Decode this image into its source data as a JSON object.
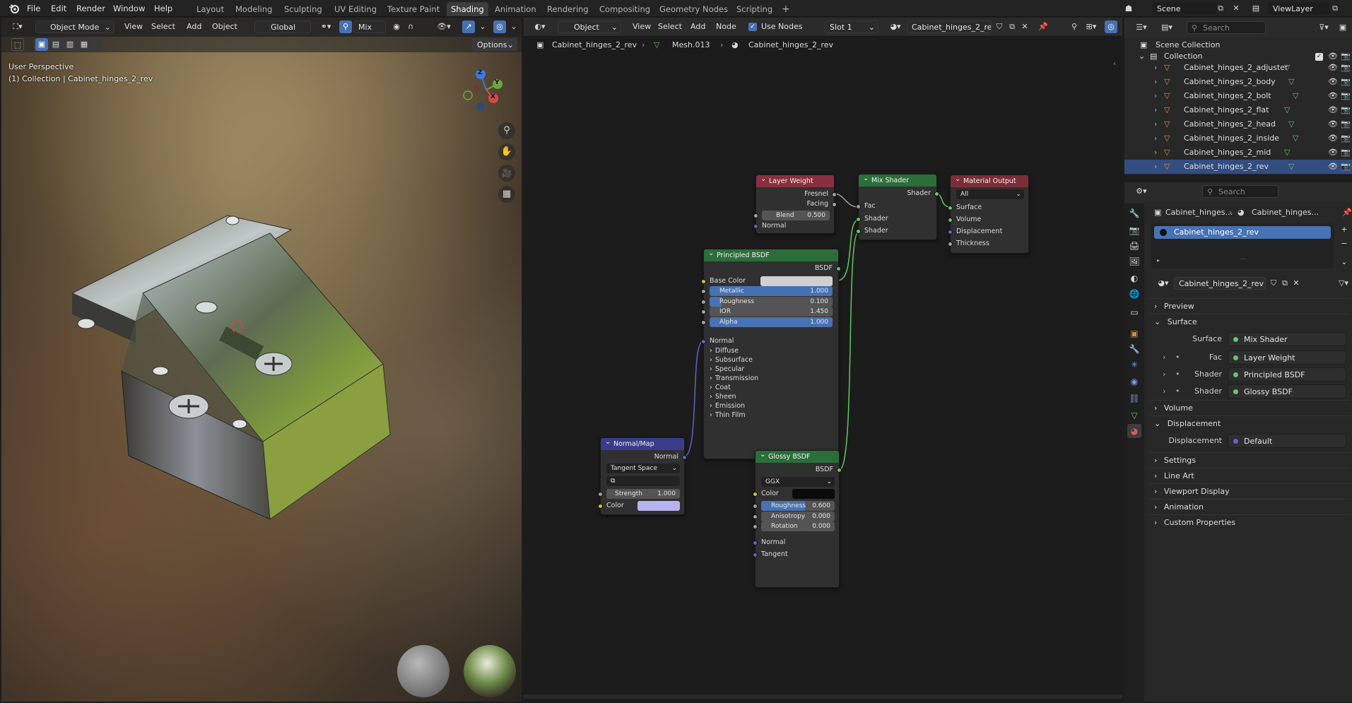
{
  "menus": [
    "File",
    "Edit",
    "Render",
    "Window",
    "Help"
  ],
  "workspaces": [
    "Layout",
    "Modeling",
    "Sculpting",
    "UV Editing",
    "Texture Paint",
    "Shading",
    "Animation",
    "Rendering",
    "Compositing",
    "Geometry Nodes",
    "Scripting"
  ],
  "active_workspace": "Shading",
  "add_workspace": "+",
  "scene_name": "Scene",
  "view_layer": "ViewLayer",
  "viewport": {
    "mode": "Object Mode",
    "menu": [
      "View",
      "Select",
      "Add",
      "Object"
    ],
    "orientation": "Global",
    "proportional": "Mix",
    "options_label": "Options",
    "overlay_line1": "User Perspective",
    "overlay_line2": "(1) Collection | Cabinet_hinges_2_rev",
    "gizmo_axes": {
      "z": "Z",
      "y": "Y",
      "x": "X"
    }
  },
  "node_editor": {
    "type": "Object",
    "menu": [
      "View",
      "Select",
      "Add",
      "Node"
    ],
    "use_nodes_label": "Use Nodes",
    "slot": "Slot 1",
    "material": "Cabinet_hinges_2_rev",
    "breadcrumb": [
      "Cabinet_hinges_2_rev",
      "Mesh.013",
      "Cabinet_hinges_2_rev"
    ],
    "nodes": {
      "layer_weight": {
        "title": "Layer Weight",
        "out1": "Fresnel",
        "out2": "Facing",
        "blend_label": "Blend",
        "blend_value": "0.500",
        "normal": "Normal"
      },
      "mix_shader": {
        "title": "Mix Shader",
        "out": "Shader",
        "in1": "Fac",
        "in2": "Shader",
        "in3": "Shader"
      },
      "material_output": {
        "title": "Material Output",
        "target": "All",
        "in1": "Surface",
        "in2": "Volume",
        "in3": "Displacement",
        "in4": "Thickness"
      },
      "principled": {
        "title": "Principled BSDF",
        "out": "BSDF",
        "base_color": "Base Color",
        "fields": [
          {
            "label": "Metallic",
            "value": "1.000",
            "fill": 1.0
          },
          {
            "label": "Roughness",
            "value": "0.100",
            "fill": 0.1
          },
          {
            "label": "IOR",
            "value": "1.450",
            "fill": 0
          },
          {
            "label": "Alpha",
            "value": "1.000",
            "fill": 1.0
          }
        ],
        "normal": "Normal",
        "panels": [
          "Diffuse",
          "Subsurface",
          "Specular",
          "Transmission",
          "Coat",
          "Sheen",
          "Emission",
          "Thin Film"
        ]
      },
      "normal_map": {
        "title": "Normal/Map",
        "out": "Normal",
        "space": "Tangent Space",
        "strength_label": "Strength",
        "strength_value": "1.000",
        "color": "Color"
      },
      "glossy": {
        "title": "Glossy BSDF",
        "out": "BSDF",
        "distribution": "GGX",
        "color": "Color",
        "fields": [
          {
            "label": "Roughness",
            "value": "0.600",
            "fill": 0.6
          },
          {
            "label": "Anisotropy",
            "value": "0.000",
            "fill": 0
          },
          {
            "label": "Rotation",
            "value": "0.000",
            "fill": 0
          }
        ],
        "normal": "Normal",
        "tangent": "Tangent"
      }
    }
  },
  "outliner": {
    "search_placeholder": "Search",
    "root": "Scene Collection",
    "collection": "Collection",
    "items": [
      "Cabinet_hinges_2_adjuster",
      "Cabinet_hinges_2_body",
      "Cabinet_hinges_2_bolt",
      "Cabinet_hinges_2_flat",
      "Cabinet_hinges_2_head",
      "Cabinet_hinges_2_inside",
      "Cabinet_hinges_2_mid",
      "Cabinet_hinges_2_rev"
    ]
  },
  "properties": {
    "search_placeholder": "Search",
    "breadcrumb": [
      "Cabinet_hinges...",
      "Cabinet_hinges..."
    ],
    "slot_item": "Cabinet_hinges_2_rev",
    "material_name": "Cabinet_hinges_2_rev",
    "sections": {
      "preview": "Preview",
      "surface": "Surface",
      "volume": "Volume",
      "displacement": "Displacement",
      "settings": "Settings",
      "line_art": "Line Art",
      "viewport_display": "Viewport Display",
      "animation": "Animation",
      "custom_properties": "Custom Properties"
    },
    "surface_rows": [
      {
        "label": "Surface",
        "value": "Mix Shader"
      },
      {
        "label": "Fac",
        "value": "Layer Weight"
      },
      {
        "label": "Shader",
        "value": "Principled BSDF"
      },
      {
        "label": "Shader",
        "value": "Glossy BSDF"
      }
    ],
    "displacement_row": {
      "label": "Displacement",
      "value": "Default"
    }
  },
  "colors": {
    "accent": "#4772b3",
    "shader_green": "#63c763",
    "node_header_green": "#2c6e3a",
    "output_red": "#7a2e38",
    "input_red": "#8a2f3e",
    "vector_purple": "#3c3c8c"
  }
}
